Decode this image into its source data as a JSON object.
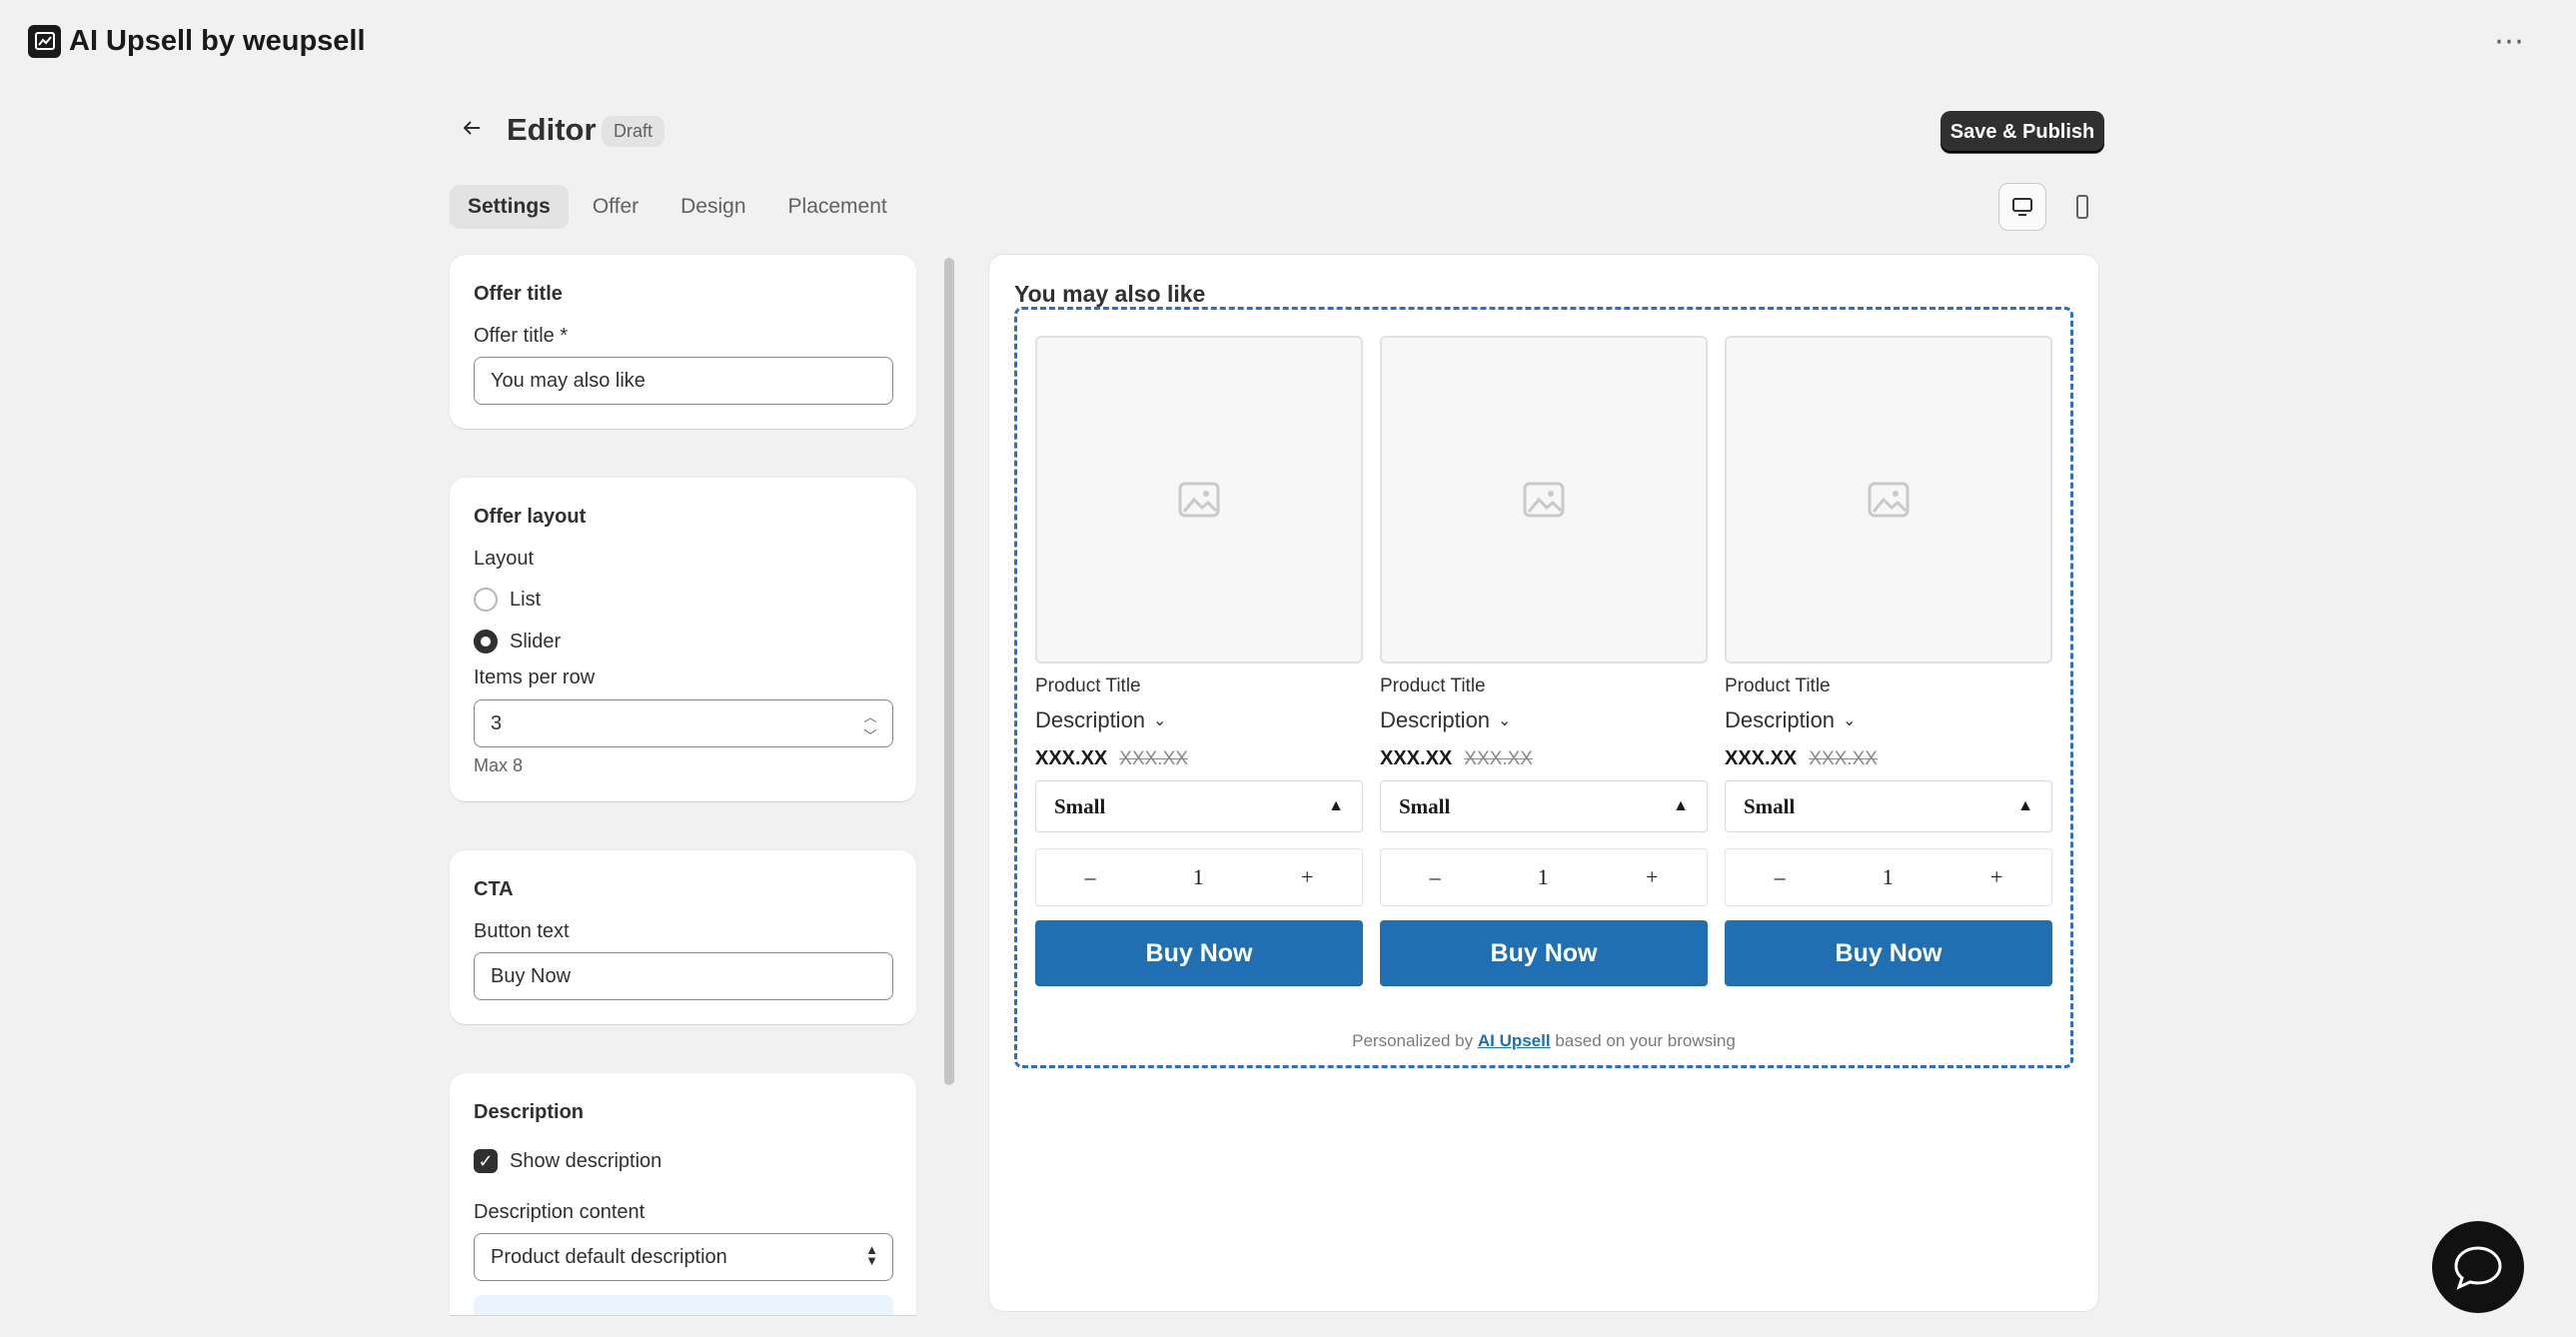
{
  "app": {
    "title": "AI Upsell by weupsell",
    "more_icon": "more-horizontal-icon"
  },
  "header": {
    "title": "Editor",
    "badge": "Draft",
    "publish_label": "Save & Publish"
  },
  "tabs": [
    {
      "label": "Settings",
      "active": true
    },
    {
      "label": "Offer",
      "active": false
    },
    {
      "label": "Design",
      "active": false
    },
    {
      "label": "Placement",
      "active": false
    }
  ],
  "settings": {
    "offer_title": {
      "heading": "Offer title",
      "label": "Offer title *",
      "value": "You may also like"
    },
    "offer_layout": {
      "heading": "Offer layout",
      "layout_label": "Layout",
      "options": [
        {
          "label": "List",
          "selected": false
        },
        {
          "label": "Slider",
          "selected": true
        }
      ],
      "items_label": "Items per row",
      "items_value": "3",
      "items_hint": "Max 8"
    },
    "cta": {
      "heading": "CTA",
      "label": "Button text",
      "value": "Buy Now"
    },
    "description": {
      "heading": "Description",
      "show_label": "Show description",
      "show_checked": true,
      "content_label": "Description content",
      "content_value": "Product default description"
    }
  },
  "preview": {
    "title": "You may also like",
    "products": [
      {
        "title": "Product Title",
        "description": "Description",
        "price": "XXX.XX",
        "compare_price": "XXX.XX",
        "variant": "Small",
        "qty_minus": "–",
        "qty": "1",
        "qty_plus": "+",
        "cta": "Buy Now"
      },
      {
        "title": "Product Title",
        "description": "Description",
        "price": "XXX.XX",
        "compare_price": "XXX.XX",
        "variant": "Small",
        "qty_minus": "–",
        "qty": "1",
        "qty_plus": "+",
        "cta": "Buy Now"
      },
      {
        "title": "Product Title",
        "description": "Description",
        "price": "XXX.XX",
        "compare_price": "XXX.XX",
        "variant": "Small",
        "qty_minus": "–",
        "qty": "1",
        "qty_plus": "+",
        "cta": "Buy Now"
      }
    ],
    "footer_prefix": "Personalized by",
    "footer_link": "AI Upsell",
    "footer_suffix": "based on your browsing"
  },
  "colors": {
    "accent": "#1f6fb2",
    "primary_button": "#303030",
    "dashed_border": "#2c6ecb"
  }
}
